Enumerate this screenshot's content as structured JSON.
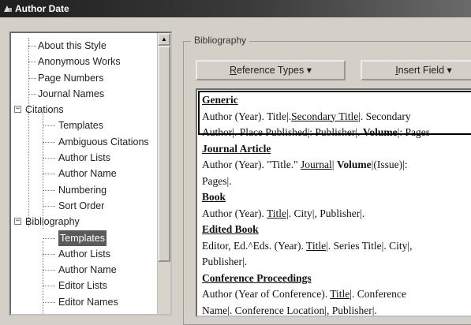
{
  "window": {
    "title": "Author Date"
  },
  "tree": {
    "items": [
      {
        "label": "About this Style",
        "level": 1
      },
      {
        "label": "Anonymous Works",
        "level": 1
      },
      {
        "label": "Page Numbers",
        "level": 1
      },
      {
        "label": "Journal Names",
        "level": 1
      },
      {
        "label": "Citations",
        "level": 0,
        "expander": "−"
      },
      {
        "label": "Templates",
        "level": 2
      },
      {
        "label": "Ambiguous Citations",
        "level": 2
      },
      {
        "label": "Author Lists",
        "level": 2
      },
      {
        "label": "Author Name",
        "level": 2
      },
      {
        "label": "Numbering",
        "level": 2
      },
      {
        "label": "Sort Order",
        "level": 2
      },
      {
        "label": "Bibliography",
        "level": 0,
        "expander": "−"
      },
      {
        "label": "Templates",
        "level": 2,
        "selected": true
      },
      {
        "label": "Author Lists",
        "level": 2
      },
      {
        "label": "Author Name",
        "level": 2
      },
      {
        "label": "Editor Lists",
        "level": 2
      },
      {
        "label": "Editor Names",
        "level": 2
      }
    ]
  },
  "panel": {
    "group_label": "Bibliography",
    "reference_types_button": {
      "underlined": "R",
      "text": "eference Types",
      "arrow": "▾"
    },
    "insert_field_button": {
      "underlined": "I",
      "text": "nsert Field",
      "arrow": "▾"
    }
  },
  "editor": {
    "templates": [
      {
        "heading": "Generic",
        "lines": [
          [
            {
              "t": "Author (Year). Title|.",
              "s": ""
            },
            {
              "t": "Secondary Title",
              "s": "u"
            },
            {
              "t": "|. Secondary",
              "s": ""
            }
          ],
          [
            {
              "t": "Author|. Place Published|: Publisher|. ",
              "s": ""
            },
            {
              "t": "Volume",
              "s": "b"
            },
            {
              "t": "|: Pages",
              "s": ""
            }
          ]
        ]
      },
      {
        "heading": "Journal Article",
        "lines": [
          [
            {
              "t": "Author (Year). \"Title.\" ",
              "s": ""
            },
            {
              "t": "Journal",
              "s": "u"
            },
            {
              "t": "| ",
              "s": ""
            },
            {
              "t": "Volume",
              "s": "b"
            },
            {
              "t": "|(Issue)|:",
              "s": ""
            }
          ],
          [
            {
              "t": "Pages|.",
              "s": ""
            }
          ]
        ]
      },
      {
        "heading": "Book",
        "lines": [
          [
            {
              "t": "Author (Year). ",
              "s": ""
            },
            {
              "t": "Title",
              "s": "u"
            },
            {
              "t": "|. City|, Publisher|.",
              "s": ""
            }
          ]
        ]
      },
      {
        "heading": "Edited Book",
        "lines": [
          [
            {
              "t": "Editor, Ed.^Eds. (Year). ",
              "s": ""
            },
            {
              "t": "Title",
              "s": "u"
            },
            {
              "t": "|. Series Title|. City|,",
              "s": ""
            }
          ],
          [
            {
              "t": "Publisher|.",
              "s": ""
            }
          ]
        ]
      },
      {
        "heading": "Conference Proceedings",
        "lines": [
          [
            {
              "t": "Author (Year of Conference). ",
              "s": ""
            },
            {
              "t": "Title",
              "s": "u"
            },
            {
              "t": "|. Conference",
              "s": ""
            }
          ],
          [
            {
              "t": "Name|. Conference Location|, Publisher|.",
              "s": ""
            }
          ]
        ]
      }
    ]
  }
}
